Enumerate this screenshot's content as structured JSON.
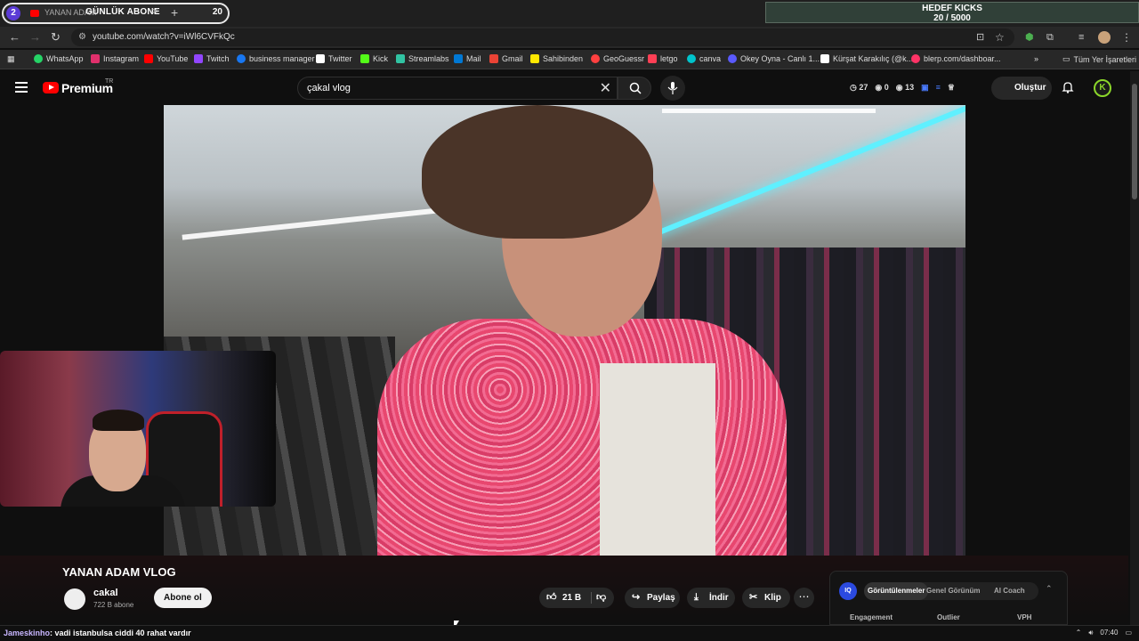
{
  "browser": {
    "tab": {
      "group_badge": "2",
      "title": "YANAN ADAM",
      "overlay_label": "GÜNLÜK ABONE",
      "count": "20"
    },
    "url": "youtube.com/watch?v=iWl6CVFkQc",
    "bookmarks": [
      {
        "label": "WhatsApp",
        "color": "#25d366"
      },
      {
        "label": "Instagram",
        "color": "#e1306c"
      },
      {
        "label": "YouTube",
        "color": "#ff0000"
      },
      {
        "label": "Twitch",
        "color": "#9146ff"
      },
      {
        "label": "business manager",
        "color": "#1877f2"
      },
      {
        "label": "Twitter",
        "color": "#ffffff"
      },
      {
        "label": "Kick",
        "color": "#53fc18"
      },
      {
        "label": "Streamlabs",
        "color": "#31c3a2"
      },
      {
        "label": "Mail",
        "color": "#0078d4"
      },
      {
        "label": "Gmail",
        "color": "#ea4335"
      },
      {
        "label": "Sahibinden",
        "color": "#ffe800"
      },
      {
        "label": "GeoGuessr",
        "color": "#ff4040"
      },
      {
        "label": "letgo",
        "color": "#ff3f55"
      },
      {
        "label": "canva",
        "color": "#00c4cc"
      },
      {
        "label": "Okey Oyna - Canlı 1...",
        "color": "#5a5aff"
      },
      {
        "label": "Kürşat Karakılıç (@k...",
        "color": "#ffffff"
      },
      {
        "label": "blerp.com/dashboar...",
        "color": "#ff3366"
      }
    ],
    "all_bookmarks_label": "Tüm Yer İşaretleri"
  },
  "kick_goal": {
    "title": "HEDEF KICKS",
    "progress": "20 / 5000"
  },
  "youtube": {
    "logo_text": "Premium",
    "country_code": "TR",
    "search_query": "çakal vlog",
    "stats": [
      "27",
      "0",
      "13"
    ],
    "create_label": "Oluştur",
    "avatar_letter": "K"
  },
  "video": {
    "title": "YANAN ADAM VLOG",
    "channel": "cakal",
    "subscribers": "722 B abone",
    "subscribe_label": "Abone ol",
    "likes": "21 B",
    "share_label": "Paylaş",
    "download_label": "İndir",
    "clip_label": "Klip"
  },
  "iq_panel": {
    "logo": "IQ",
    "tabs": [
      "Görüntülenmeler",
      "Genel Görünüm",
      "AI Coach"
    ],
    "columns": [
      "Engagement",
      "Outlier",
      "VPH"
    ]
  },
  "ticker": {
    "user": "Jameskinho",
    "message": ": vadi istanbulsa ciddi 40 rahat vardır"
  },
  "taskbar": {
    "time": "07:40"
  }
}
